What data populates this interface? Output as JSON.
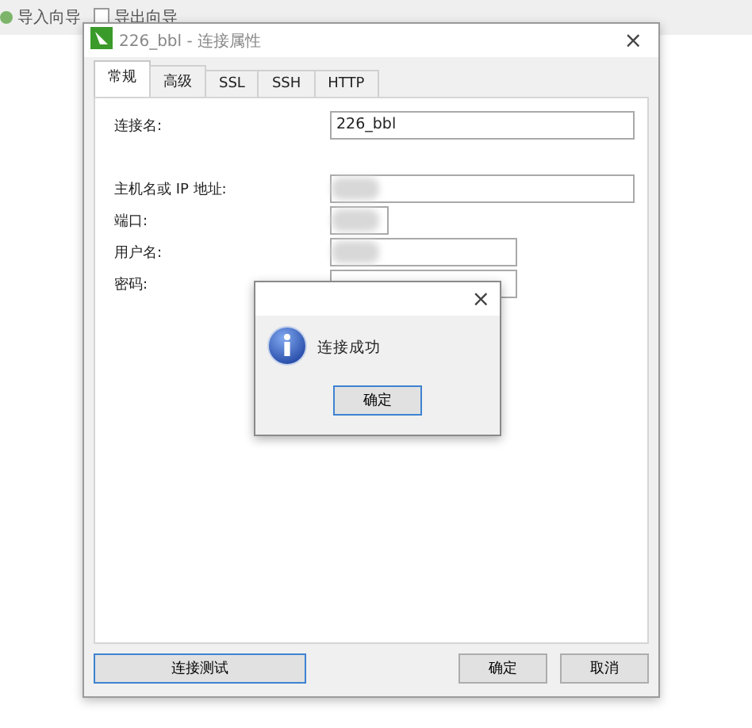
{
  "toolbar": {
    "items": [
      {
        "label": "导入向导"
      },
      {
        "label": "导出向导"
      }
    ]
  },
  "window": {
    "title": "226_bbl - 连接属性",
    "close": "×"
  },
  "tabs": [
    {
      "label": "常规",
      "selected": true
    },
    {
      "label": "高级",
      "selected": false
    },
    {
      "label": "SSL",
      "selected": false
    },
    {
      "label": "SSH",
      "selected": false
    },
    {
      "label": "HTTP",
      "selected": false
    }
  ],
  "fields": [
    {
      "label": "连接名:",
      "value": "226_bbl",
      "redacted": false
    },
    {
      "label": "主机名或 IP 地址:",
      "redacted": true
    },
    {
      "label": "端口:",
      "redacted": true
    },
    {
      "label": "用户名:",
      "redacted": true
    },
    {
      "label": "密码:",
      "redacted": false
    }
  ],
  "buttons": {
    "test": "连接测试",
    "ok": "确定",
    "cancel": "取消"
  },
  "message_box": {
    "close": "×",
    "message": "连接成功",
    "button": "确定"
  }
}
